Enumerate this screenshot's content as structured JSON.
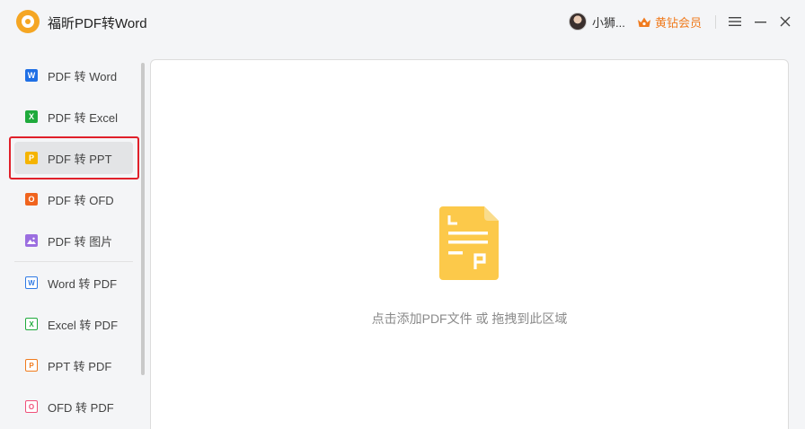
{
  "app": {
    "title": "福昕PDF转Word"
  },
  "header": {
    "user_name": "小狮...",
    "vip_label": "黄钻会员",
    "accent_color": "#f07b1e"
  },
  "sidebar": {
    "items": [
      {
        "label": "PDF 转 Word",
        "icon": "W",
        "icon_name": "word-icon",
        "color": "#1f6fe5"
      },
      {
        "label": "PDF 转 Excel",
        "icon": "X",
        "icon_name": "excel-icon",
        "color": "#1faa3c"
      },
      {
        "label": "PDF 转 PPT",
        "icon": "P",
        "icon_name": "ppt-icon",
        "color": "#f5b400",
        "active": true
      },
      {
        "label": "PDF 转 OFD",
        "icon": "O",
        "icon_name": "ofd-icon",
        "color": "#f0641e"
      },
      {
        "label": "PDF 转 图片",
        "icon": "",
        "icon_name": "image-icon",
        "color": "#9b6ee0"
      },
      {
        "label": "Word 转 PDF",
        "icon": "W",
        "icon_name": "word-to-pdf-icon",
        "color": "#2f7ae5"
      },
      {
        "label": "Excel 转 PDF",
        "icon": "X",
        "icon_name": "excel-to-pdf-icon",
        "color": "#1faa3c"
      },
      {
        "label": "PPT 转 PDF",
        "icon": "P",
        "icon_name": "ppt-to-pdf-icon",
        "color": "#f07b1e"
      },
      {
        "label": "OFD 转 PDF",
        "icon": "O",
        "icon_name": "ofd-to-pdf-icon",
        "color": "#f0507a"
      }
    ]
  },
  "main": {
    "drop_hint": "点击添加PDF文件 或 拖拽到此区域",
    "drop_icon": "ppt-file-icon",
    "drop_icon_color": "#fcc94a"
  }
}
